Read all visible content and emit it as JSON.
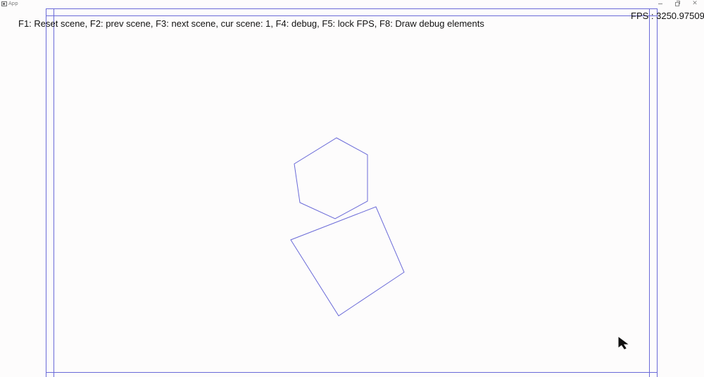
{
  "window": {
    "title": "App",
    "minimize_label": "—",
    "close_label": "✕"
  },
  "hud": {
    "help": "F1: Reset scene, F2: prev scene, F3: next scene, cur scene: 1, F4: debug, F5: lock FPS, F8: Draw debug elements",
    "fps": "FPS : 3250.975098"
  },
  "colors": {
    "background": "#fdfcfc",
    "outline": "#6a6ad8",
    "text": "#111111"
  },
  "scene": {
    "shapes": [
      {
        "name": "hexagon",
        "type": "polygon",
        "sides": 6
      },
      {
        "name": "rectangle",
        "type": "polygon",
        "sides": 4
      }
    ],
    "debug_bounds": true
  },
  "icons": {
    "app": "app-window-icon",
    "cursor": "mouse-pointer-icon"
  }
}
